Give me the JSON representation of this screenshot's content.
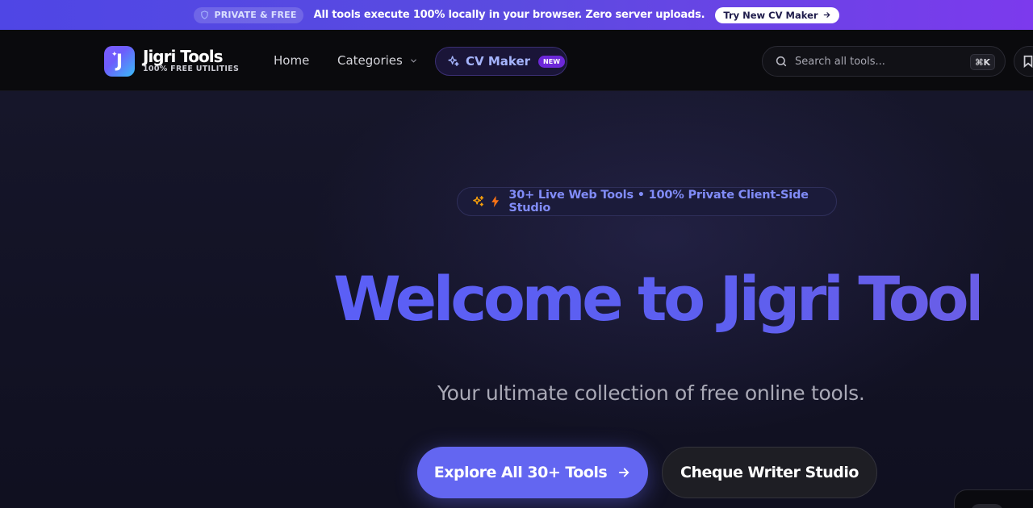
{
  "announcement": {
    "badge_label": "PRIVATE & FREE",
    "message": "All tools execute 100% locally in your browser. Zero server uploads.",
    "cta_label": "Try New CV Maker"
  },
  "brand": {
    "logo_letter": "J",
    "name": "Jigri Tools",
    "tagline": "100% FREE UTILITIES"
  },
  "nav": {
    "home_label": "Home",
    "categories_label": "Categories",
    "cv_maker_label": "CV Maker",
    "new_badge": "NEW"
  },
  "search": {
    "placeholder": "Search all tools...",
    "shortcut": "⌘K"
  },
  "hero": {
    "badge_text": "30+ Live Web Tools • 100% Private Client-Side Studio",
    "title": "Welcome to Jigri Tools",
    "subtitle": "Your ultimate collection of free online tools.",
    "primary_button": "Explore All 30+ Tools",
    "secondary_button": "Cheque Writer Studio"
  },
  "colors": {
    "accent": "#6366f1",
    "announcement_gradient_start": "#4f46e5",
    "announcement_gradient_end": "#7c3aed",
    "nav_background": "#0a0a0d",
    "hero_background": "#14142a",
    "badge_text": "#818cf8",
    "bolt": "#f97316"
  },
  "icons": {
    "badge": "shield-icon",
    "cta": "arrow-right-icon",
    "categories": "chevron-down-icon",
    "cv_maker": "sparkles-icon",
    "search": "search-icon",
    "bookmark": "bookmark-icon",
    "hero_badge": [
      "sparkles-icon",
      "lightning-icon"
    ],
    "primary_button": "arrow-right-icon"
  }
}
